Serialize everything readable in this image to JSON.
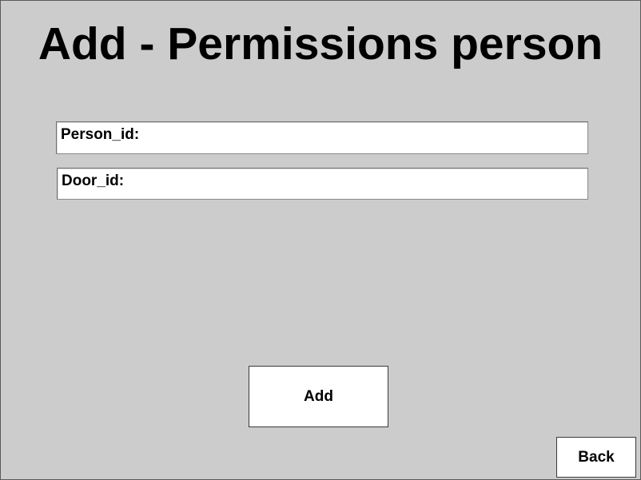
{
  "page": {
    "title": "Add - Permissions person"
  },
  "form": {
    "person_id": {
      "label": "Person_id:",
      "value": ""
    },
    "door_id": {
      "label": "Door_id:",
      "value": ""
    }
  },
  "buttons": {
    "add_label": "Add",
    "back_label": "Back"
  },
  "colors": {
    "background": "#cccccc",
    "field_background": "#ffffff",
    "text": "#000000"
  }
}
